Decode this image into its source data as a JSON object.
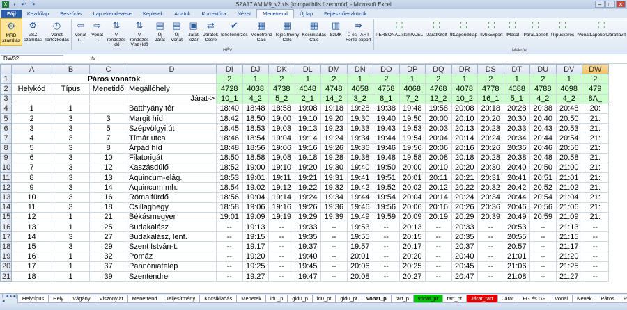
{
  "window": {
    "title": "SZA17 AM M9_v2.xls  [kompatibilis üzemmód]  -  Microsoft Excel"
  },
  "ribbon_tabs": [
    "Fájl",
    "Kezdőlap",
    "Beszúrás",
    "Lap elrendezése",
    "Képletek",
    "Adatok",
    "Korrektúra",
    "Nézet",
    "Menetrend",
    "Új lap",
    "Fejlesztőeszközök"
  ],
  "active_tab": "Menetrend",
  "ribbon_buttons": [
    {
      "label": "MRD számítás",
      "icon": "gears-icon"
    },
    {
      "label": "VSZ számítás",
      "icon": "gears-icon"
    },
    {
      "label": "Vonat Tartózkodás",
      "icon": "clock-icon"
    },
    {
      "label": "Vonat i←",
      "icon": "left-arrow-icon"
    },
    {
      "label": "Vonat i→",
      "icon": "right-arrow-icon"
    },
    {
      "label": "V rendezés Idő",
      "icon": "sort-icon"
    },
    {
      "label": "V rendezés Visz+Idő",
      "icon": "sort-icon"
    },
    {
      "label": "Új Járat",
      "icon": "new-icon"
    },
    {
      "label": "Új Vonat",
      "icon": "new-icon"
    },
    {
      "label": "Járat lezár",
      "icon": "lock-icon"
    },
    {
      "label": "Járatok Csere",
      "icon": "swap-icon"
    },
    {
      "label": "Időellenőrzés",
      "icon": "check-icon"
    },
    {
      "label": "Menetrend Calc",
      "icon": "calc-icon"
    },
    {
      "label": "Tejesítmény Calc",
      "icon": "calc-icon"
    },
    {
      "label": "Kocsikiadás Calc",
      "icon": "calc-icon"
    },
    {
      "label": "SzMK",
      "icon": "doc-icon"
    },
    {
      "label": "Ü és TART ForTe export",
      "icon": "export-icon"
    },
    {
      "label": "PERSONAL.xlsm!VJEL",
      "icon": "tree-icon"
    },
    {
      "label": "!JáratKitölt",
      "icon": "tree-icon"
    },
    {
      "label": "!ItLaporidőlap",
      "icon": "tree-icon"
    },
    {
      "label": "!IvbkExport",
      "icon": "tree-icon"
    },
    {
      "label": "!Masol",
      "icon": "tree-icon"
    },
    {
      "label": "!ParaLapTölt",
      "icon": "tree-icon"
    },
    {
      "label": "!Tipuskeres",
      "icon": "tree-icon"
    },
    {
      "label": "!VonatLapokonJáratlavít",
      "icon": "tree-icon"
    }
  ],
  "ribbon_groups": {
    "hev": "HÉV",
    "macros": "Makrók"
  },
  "namebox": "DW32",
  "fx": "fx",
  "columns": [
    "A",
    "B",
    "C",
    "D",
    "DI",
    "DJ",
    "DK",
    "DL",
    "DM",
    "DN",
    "DO",
    "DP",
    "DQ",
    "DR",
    "DS",
    "DT",
    "DU",
    "DV",
    "DW"
  ],
  "row1_title": "Páros vonatok",
  "headers": {
    "helykod": "Helykód",
    "tipus": "Típus",
    "menetido": "Menetidő",
    "megallohely": "Megállóhely",
    "jarat": "Járat->"
  },
  "row1_vals": [
    "2",
    "1",
    "2",
    "1",
    "2",
    "1",
    "2",
    "1",
    "2",
    "1",
    "2",
    "1",
    "2",
    "1",
    "2"
  ],
  "row2_vals": [
    "4728",
    "4038",
    "4738",
    "4048",
    "4748",
    "4058",
    "4758",
    "4068",
    "4768",
    "4078",
    "4778",
    "4088",
    "4788",
    "4098",
    "479"
  ],
  "row3_vals": [
    "10_1",
    "4_2",
    "5_2",
    "2_1",
    "14_2",
    "3_2",
    "8_1",
    "7_2",
    "12_2",
    "10_2",
    "16_1",
    "5_1",
    "4_2",
    "4_2",
    "8A_"
  ],
  "rows": [
    {
      "n": "4",
      "a": "1",
      "b": "1",
      "c": "",
      "d": "Batthyány tér",
      "t": [
        "18:40",
        "18:48",
        "18:58",
        "19:08",
        "19:18",
        "19:28",
        "19:38",
        "19:48",
        "19:58",
        "20:08",
        "20:18",
        "20:28",
        "20:38",
        "20:48",
        "20:"
      ]
    },
    {
      "n": "5",
      "a": "2",
      "b": "3",
      "c": "3",
      "d": "Margit híd",
      "t": [
        "18:42",
        "18:50",
        "19:00",
        "19:10",
        "19:20",
        "19:30",
        "19:40",
        "19:50",
        "20:00",
        "20:10",
        "20:20",
        "20:30",
        "20:40",
        "20:50",
        "21:"
      ]
    },
    {
      "n": "6",
      "a": "3",
      "b": "3",
      "c": "5",
      "d": "Szépvölgyi út",
      "t": [
        "18:45",
        "18:53",
        "19:03",
        "19:13",
        "19:23",
        "19:33",
        "19:43",
        "19:53",
        "20:03",
        "20:13",
        "20:23",
        "20:33",
        "20:43",
        "20:53",
        "21:"
      ]
    },
    {
      "n": "7",
      "a": "4",
      "b": "3",
      "c": "7",
      "d": "Tímár utca",
      "t": [
        "18:46",
        "18:54",
        "19:04",
        "19:14",
        "19:24",
        "19:34",
        "19:44",
        "19:54",
        "20:04",
        "20:14",
        "20:24",
        "20:34",
        "20:44",
        "20:54",
        "21:"
      ]
    },
    {
      "n": "8",
      "a": "5",
      "b": "3",
      "c": "8",
      "d": "Árpád híd",
      "t": [
        "18:48",
        "18:56",
        "19:06",
        "19:16",
        "19:26",
        "19:36",
        "19:46",
        "19:56",
        "20:06",
        "20:16",
        "20:26",
        "20:36",
        "20:46",
        "20:56",
        "21:"
      ]
    },
    {
      "n": "9",
      "a": "6",
      "b": "3",
      "c": "10",
      "d": "Filatorigát",
      "t": [
        "18:50",
        "18:58",
        "19:08",
        "19:18",
        "19:28",
        "19:38",
        "19:48",
        "19:58",
        "20:08",
        "20:18",
        "20:28",
        "20:38",
        "20:48",
        "20:58",
        "21:"
      ]
    },
    {
      "n": "10",
      "a": "7",
      "b": "3",
      "c": "12",
      "d": "Kaszásdűlő",
      "t": [
        "18:52",
        "19:00",
        "19:10",
        "19:20",
        "19:30",
        "19:40",
        "19:50",
        "20:00",
        "20:10",
        "20:20",
        "20:30",
        "20:40",
        "20:50",
        "21:00",
        "21:"
      ]
    },
    {
      "n": "11",
      "a": "8",
      "b": "3",
      "c": "13",
      "d": "Aquincum-elág.",
      "t": [
        "18:53",
        "19:01",
        "19:11",
        "19:21",
        "19:31",
        "19:41",
        "19:51",
        "20:01",
        "20:11",
        "20:21",
        "20:31",
        "20:41",
        "20:51",
        "21:01",
        "21:"
      ]
    },
    {
      "n": "12",
      "a": "9",
      "b": "3",
      "c": "14",
      "d": "Aquincum mh.",
      "t": [
        "18:54",
        "19:02",
        "19:12",
        "19:22",
        "19:32",
        "19:42",
        "19:52",
        "20:02",
        "20:12",
        "20:22",
        "20:32",
        "20:42",
        "20:52",
        "21:02",
        "21:"
      ]
    },
    {
      "n": "13",
      "a": "10",
      "b": "3",
      "c": "16",
      "d": "Rómaifürdő",
      "t": [
        "18:56",
        "19:04",
        "19:14",
        "19:24",
        "19:34",
        "19:44",
        "19:54",
        "20:04",
        "20:14",
        "20:24",
        "20:34",
        "20:44",
        "20:54",
        "21:04",
        "21:"
      ]
    },
    {
      "n": "14",
      "a": "11",
      "b": "3",
      "c": "18",
      "d": "Csillaghegy",
      "t": [
        "18:58",
        "19:06",
        "19:16",
        "19:26",
        "19:36",
        "19:46",
        "19:56",
        "20:06",
        "20:16",
        "20:26",
        "20:36",
        "20:46",
        "20:56",
        "21:06",
        "21:"
      ]
    },
    {
      "n": "15",
      "a": "12",
      "b": "1",
      "c": "21",
      "d": "Békásmegyer",
      "t": [
        "19:01",
        "19:09",
        "19:19",
        "19:29",
        "19:39",
        "19:49",
        "19:59",
        "20:09",
        "20:19",
        "20:29",
        "20:39",
        "20:49",
        "20:59",
        "21:09",
        "21:"
      ]
    },
    {
      "n": "16",
      "a": "13",
      "b": "1",
      "c": "25",
      "d": "Budakalász",
      "t": [
        "--",
        "19:13",
        "--",
        "19:33",
        "--",
        "19:53",
        "--",
        "20:13",
        "--",
        "20:33",
        "--",
        "20:53",
        "--",
        "21:13",
        "--"
      ]
    },
    {
      "n": "17",
      "a": "14",
      "b": "3",
      "c": "27",
      "d": "Budakalász, lenf.",
      "t": [
        "--",
        "19:15",
        "--",
        "19:35",
        "--",
        "19:55",
        "--",
        "20:15",
        "--",
        "20:35",
        "--",
        "20:55",
        "--",
        "21:15",
        "--"
      ]
    },
    {
      "n": "18",
      "a": "15",
      "b": "3",
      "c": "29",
      "d": "Szent István-t.",
      "t": [
        "--",
        "19:17",
        "--",
        "19:37",
        "--",
        "19:57",
        "--",
        "20:17",
        "--",
        "20:37",
        "--",
        "20:57",
        "--",
        "21:17",
        "--"
      ]
    },
    {
      "n": "19",
      "a": "16",
      "b": "1",
      "c": "32",
      "d": "Pomáz",
      "t": [
        "--",
        "19:20",
        "--",
        "19:40",
        "--",
        "20:01",
        "--",
        "20:20",
        "--",
        "20:40",
        "--",
        "21:01",
        "--",
        "21:20",
        "--"
      ]
    },
    {
      "n": "20",
      "a": "17",
      "b": "1",
      "c": "37",
      "d": "Pannóniatelep",
      "t": [
        "--",
        "19:25",
        "--",
        "19:45",
        "--",
        "20:06",
        "--",
        "20:25",
        "--",
        "20:45",
        "--",
        "21:06",
        "--",
        "21:25",
        "--"
      ]
    },
    {
      "n": "21",
      "a": "18",
      "b": "1",
      "c": "39",
      "d": "Szentendre",
      "t": [
        "--",
        "19:27",
        "--",
        "19:47",
        "--",
        "20:08",
        "--",
        "20:27",
        "--",
        "20:47",
        "--",
        "21:08",
        "--",
        "21:27",
        "--"
      ]
    }
  ],
  "sheet_tabs": [
    {
      "name": "Helytípus",
      "style": ""
    },
    {
      "name": "Hely",
      "style": ""
    },
    {
      "name": "Vágány",
      "style": ""
    },
    {
      "name": "Viszonylat",
      "style": ""
    },
    {
      "name": "Menetrend",
      "style": ""
    },
    {
      "name": "Teljesítmény",
      "style": ""
    },
    {
      "name": "Kocsikiadás",
      "style": ""
    },
    {
      "name": "Menetek",
      "style": ""
    },
    {
      "name": "id0_p",
      "style": ""
    },
    {
      "name": "gid0_p",
      "style": ""
    },
    {
      "name": "id0_pt",
      "style": ""
    },
    {
      "name": "gid0_pt",
      "style": ""
    },
    {
      "name": "vonat_p",
      "style": "active"
    },
    {
      "name": "tart_p",
      "style": ""
    },
    {
      "name": "vonat_pt",
      "style": "green"
    },
    {
      "name": "tart_pt",
      "style": ""
    },
    {
      "name": "Járat_tart",
      "style": "red"
    },
    {
      "name": "Járat",
      "style": ""
    },
    {
      "name": "FG és GF",
      "style": ""
    },
    {
      "name": "Vonal",
      "style": ""
    },
    {
      "name": "Nevek",
      "style": ""
    },
    {
      "name": "Páros",
      "style": ""
    },
    {
      "name": "Páratlan",
      "style": ""
    }
  ]
}
